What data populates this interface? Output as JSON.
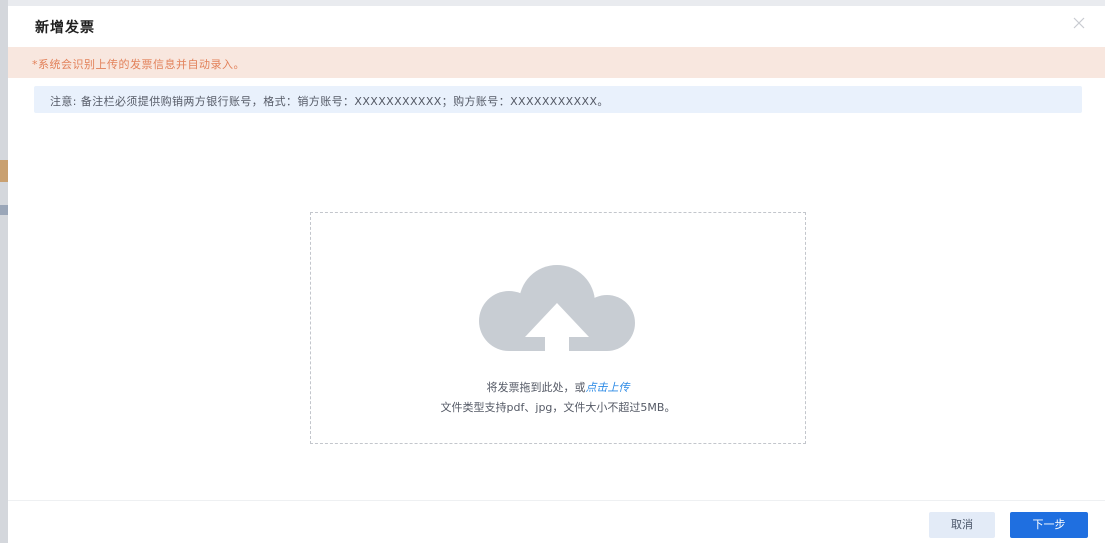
{
  "dialog": {
    "title": "新增发票",
    "close_icon": "close-icon"
  },
  "notice": {
    "text": "*系统会识别上传的发票信息并自动录入。",
    "color": "#e2815a"
  },
  "info": {
    "text": "注意: 备注栏必须提供购销两方银行账号，格式：销方账号：XXXXXXXXXXX；购方账号：XXXXXXXXXXX。"
  },
  "upload": {
    "icon": "cloud-upload-icon",
    "hint_prefix": "将发票拖到此处，或",
    "hint_link": "点击上传",
    "sub_text": "文件类型支持pdf、jpg，文件大小不超过5MB。"
  },
  "footer": {
    "cancel_label": "取消",
    "next_label": "下一步",
    "accent": "#1f6fe0"
  }
}
